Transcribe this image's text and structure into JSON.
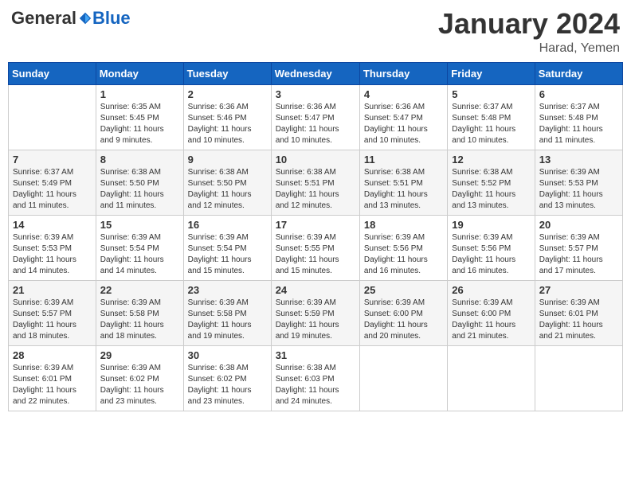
{
  "logo": {
    "general": "General",
    "blue": "Blue"
  },
  "title": "January 2024",
  "location": "Harad, Yemen",
  "days_of_week": [
    "Sunday",
    "Monday",
    "Tuesday",
    "Wednesday",
    "Thursday",
    "Friday",
    "Saturday"
  ],
  "weeks": [
    [
      {
        "day": "",
        "info": ""
      },
      {
        "day": "1",
        "info": "Sunrise: 6:35 AM\nSunset: 5:45 PM\nDaylight: 11 hours\nand 9 minutes."
      },
      {
        "day": "2",
        "info": "Sunrise: 6:36 AM\nSunset: 5:46 PM\nDaylight: 11 hours\nand 10 minutes."
      },
      {
        "day": "3",
        "info": "Sunrise: 6:36 AM\nSunset: 5:47 PM\nDaylight: 11 hours\nand 10 minutes."
      },
      {
        "day": "4",
        "info": "Sunrise: 6:36 AM\nSunset: 5:47 PM\nDaylight: 11 hours\nand 10 minutes."
      },
      {
        "day": "5",
        "info": "Sunrise: 6:37 AM\nSunset: 5:48 PM\nDaylight: 11 hours\nand 10 minutes."
      },
      {
        "day": "6",
        "info": "Sunrise: 6:37 AM\nSunset: 5:48 PM\nDaylight: 11 hours\nand 11 minutes."
      }
    ],
    [
      {
        "day": "7",
        "info": "Sunrise: 6:37 AM\nSunset: 5:49 PM\nDaylight: 11 hours\nand 11 minutes."
      },
      {
        "day": "8",
        "info": "Sunrise: 6:38 AM\nSunset: 5:50 PM\nDaylight: 11 hours\nand 11 minutes."
      },
      {
        "day": "9",
        "info": "Sunrise: 6:38 AM\nSunset: 5:50 PM\nDaylight: 11 hours\nand 12 minutes."
      },
      {
        "day": "10",
        "info": "Sunrise: 6:38 AM\nSunset: 5:51 PM\nDaylight: 11 hours\nand 12 minutes."
      },
      {
        "day": "11",
        "info": "Sunrise: 6:38 AM\nSunset: 5:51 PM\nDaylight: 11 hours\nand 13 minutes."
      },
      {
        "day": "12",
        "info": "Sunrise: 6:38 AM\nSunset: 5:52 PM\nDaylight: 11 hours\nand 13 minutes."
      },
      {
        "day": "13",
        "info": "Sunrise: 6:39 AM\nSunset: 5:53 PM\nDaylight: 11 hours\nand 13 minutes."
      }
    ],
    [
      {
        "day": "14",
        "info": "Sunrise: 6:39 AM\nSunset: 5:53 PM\nDaylight: 11 hours\nand 14 minutes."
      },
      {
        "day": "15",
        "info": "Sunrise: 6:39 AM\nSunset: 5:54 PM\nDaylight: 11 hours\nand 14 minutes."
      },
      {
        "day": "16",
        "info": "Sunrise: 6:39 AM\nSunset: 5:54 PM\nDaylight: 11 hours\nand 15 minutes."
      },
      {
        "day": "17",
        "info": "Sunrise: 6:39 AM\nSunset: 5:55 PM\nDaylight: 11 hours\nand 15 minutes."
      },
      {
        "day": "18",
        "info": "Sunrise: 6:39 AM\nSunset: 5:56 PM\nDaylight: 11 hours\nand 16 minutes."
      },
      {
        "day": "19",
        "info": "Sunrise: 6:39 AM\nSunset: 5:56 PM\nDaylight: 11 hours\nand 16 minutes."
      },
      {
        "day": "20",
        "info": "Sunrise: 6:39 AM\nSunset: 5:57 PM\nDaylight: 11 hours\nand 17 minutes."
      }
    ],
    [
      {
        "day": "21",
        "info": "Sunrise: 6:39 AM\nSunset: 5:57 PM\nDaylight: 11 hours\nand 18 minutes."
      },
      {
        "day": "22",
        "info": "Sunrise: 6:39 AM\nSunset: 5:58 PM\nDaylight: 11 hours\nand 18 minutes."
      },
      {
        "day": "23",
        "info": "Sunrise: 6:39 AM\nSunset: 5:58 PM\nDaylight: 11 hours\nand 19 minutes."
      },
      {
        "day": "24",
        "info": "Sunrise: 6:39 AM\nSunset: 5:59 PM\nDaylight: 11 hours\nand 19 minutes."
      },
      {
        "day": "25",
        "info": "Sunrise: 6:39 AM\nSunset: 6:00 PM\nDaylight: 11 hours\nand 20 minutes."
      },
      {
        "day": "26",
        "info": "Sunrise: 6:39 AM\nSunset: 6:00 PM\nDaylight: 11 hours\nand 21 minutes."
      },
      {
        "day": "27",
        "info": "Sunrise: 6:39 AM\nSunset: 6:01 PM\nDaylight: 11 hours\nand 21 minutes."
      }
    ],
    [
      {
        "day": "28",
        "info": "Sunrise: 6:39 AM\nSunset: 6:01 PM\nDaylight: 11 hours\nand 22 minutes."
      },
      {
        "day": "29",
        "info": "Sunrise: 6:39 AM\nSunset: 6:02 PM\nDaylight: 11 hours\nand 23 minutes."
      },
      {
        "day": "30",
        "info": "Sunrise: 6:38 AM\nSunset: 6:02 PM\nDaylight: 11 hours\nand 23 minutes."
      },
      {
        "day": "31",
        "info": "Sunrise: 6:38 AM\nSunset: 6:03 PM\nDaylight: 11 hours\nand 24 minutes."
      },
      {
        "day": "",
        "info": ""
      },
      {
        "day": "",
        "info": ""
      },
      {
        "day": "",
        "info": ""
      }
    ]
  ]
}
